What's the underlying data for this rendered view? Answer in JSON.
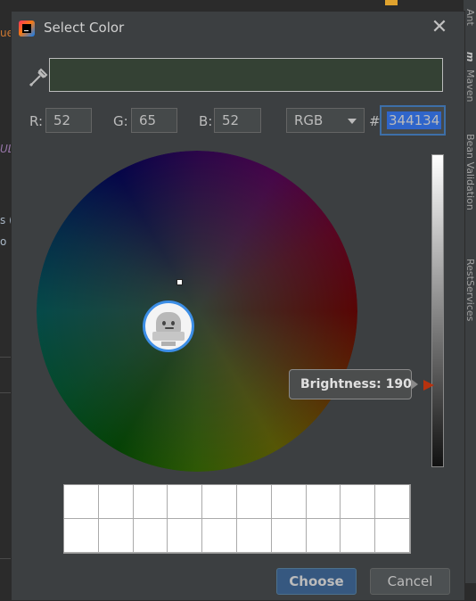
{
  "background": {
    "left_fragments": [
      "ue",
      "UL",
      "s (",
      "o ."
    ],
    "right_tools": [
      "Ant",
      "m",
      "Maven",
      "Bean Validation",
      "RestServices"
    ]
  },
  "dialog": {
    "title": "Select Color",
    "icons": {
      "app": "intellij-idea-icon",
      "close": "close-icon",
      "pipette": "color-picker-icon"
    },
    "preview_color": "#344134",
    "rgb": {
      "r_label": "R:",
      "r_value": "52",
      "g_label": "G:",
      "g_value": "65",
      "b_label": "B:",
      "b_value": "52"
    },
    "mode": {
      "selected": "RGB"
    },
    "hex": {
      "label": "#",
      "value": "344134"
    },
    "brightness_tooltip": "Brightness: 190",
    "recent_colors_cells": 20,
    "buttons": {
      "choose": "Choose",
      "cancel": "Cancel"
    }
  }
}
